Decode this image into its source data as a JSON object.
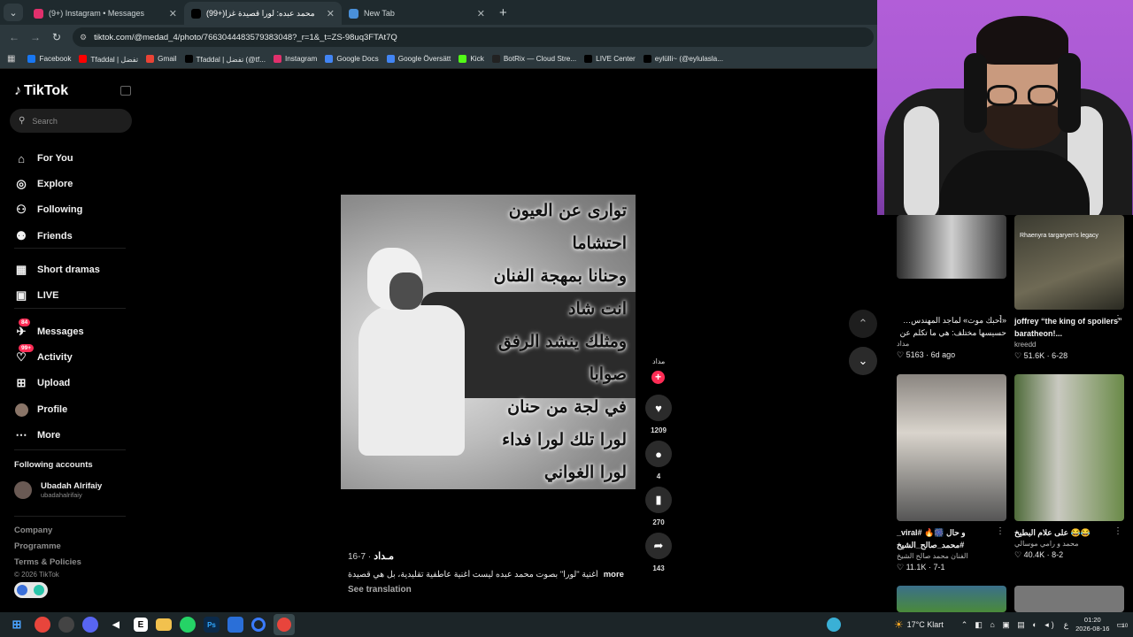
{
  "browser": {
    "tabs": [
      {
        "title": "(9+) Instagram • Messages",
        "active": false,
        "icon": "instagram-icon",
        "color": "#e1306c"
      },
      {
        "title": "(99+)محمد عبده: لورا قصيدة غزا",
        "active": true,
        "icon": "tiktok-icon",
        "color": "#000000"
      },
      {
        "title": "New Tab",
        "active": false,
        "icon": "chrome-icon",
        "color": "#4a90d9"
      }
    ],
    "url": "tiktok.com/@medad_4/photo/7663044483579383048?_r=1&_t=ZS-98uq3FTAt7Q",
    "bookmarks": [
      {
        "label": "Facebook",
        "color": "#1877f2",
        "icon": "facebook-icon"
      },
      {
        "label": "Tfaddal | تفضل",
        "color": "#ff0000",
        "icon": "youtube-icon"
      },
      {
        "label": "Gmail",
        "color": "#ea4335",
        "icon": "gmail-icon"
      },
      {
        "label": "Tfaddal | تفضل (@tf...",
        "color": "#000000",
        "icon": "tiktok-icon"
      },
      {
        "label": "Instagram",
        "color": "#e1306c",
        "icon": "instagram-icon"
      },
      {
        "label": "Google Docs",
        "color": "#4285f4",
        "icon": "docs-icon"
      },
      {
        "label": "Google Översätt",
        "color": "#4285f4",
        "icon": "translate-icon"
      },
      {
        "label": "Kick",
        "color": "#53fc18",
        "icon": "kick-icon"
      },
      {
        "label": "BotRix — Cloud Stre...",
        "color": "#222222",
        "icon": "botrix-icon"
      },
      {
        "label": "LIVE Center",
        "color": "#000000",
        "icon": "tiktok-icon"
      },
      {
        "label": "eylülli~ (@eylulasla...",
        "color": "#000000",
        "icon": "tiktok-icon"
      }
    ]
  },
  "tiktok": {
    "logo": "TikTok",
    "search_placeholder": "Search",
    "nav": [
      {
        "label": "For You",
        "icon": "home-icon"
      },
      {
        "label": "Explore",
        "icon": "compass-icon"
      },
      {
        "label": "Following",
        "icon": "following-icon"
      },
      {
        "label": "Friends",
        "icon": "friends-icon"
      },
      {
        "label": "Short dramas",
        "icon": "dramas-icon"
      },
      {
        "label": "LIVE",
        "icon": "live-icon"
      },
      {
        "label": "Messages",
        "icon": "messages-icon",
        "badge": "84"
      },
      {
        "label": "Activity",
        "icon": "activity-icon",
        "badge": "99+"
      },
      {
        "label": "Upload",
        "icon": "upload-icon"
      },
      {
        "label": "Profile",
        "icon": "avatar"
      },
      {
        "label": "More",
        "icon": "more-icon"
      }
    ],
    "following_title": "Following accounts",
    "following": {
      "name": "Ubadah Alrifaiy",
      "handle": "ubadahalrifaiy"
    },
    "footer": {
      "company": "Company",
      "programme": "Programme",
      "terms": "Terms & Policies",
      "copyright": "© 2026 TikTok"
    }
  },
  "post": {
    "poem_lines": [
      "تواری عن العیون",
      "احتشاما",
      "وحنانا بمهجة الفنان",
      "انت شاد",
      "ومثلك ينشد الرفق",
      "صوابا",
      "في لجة من حنان",
      "لورا تلك لورا فداء",
      "لورا الغواني"
    ],
    "author_short": "مداد",
    "likes": "1209",
    "comments": "4",
    "saves": "270",
    "shares": "143",
    "author": "مـداد",
    "date": "7-16",
    "caption": "أغنية \"لورا\" بصوت محمد عبده ليست أغنية عاطفية تقليدية، بل هي قصيدة",
    "more": "more",
    "see_translation": "See translation"
  },
  "recommended": [
    {
      "title": "«أحبك موت» لماجد المهندس… حسيسها مختلف: هي ما تكلم عن",
      "author": "مداد",
      "likes": "5163",
      "age": "6d ago",
      "thumb_text": ""
    },
    {
      "title": "joffrey “the king of spoilers” baratheon!...",
      "author": "kreedd",
      "likes": "51.6K",
      "age": "6-28",
      "thumb_text": "Rhaenyra targaryen's legacy"
    },
    {
      "title": "و حال 🎆🔥 #viral_ #محمد_صالح_الشيخ",
      "author": "الفنان محمد صالح الشيخ",
      "likes": "11.1K",
      "age": "7-1",
      "thumb_text": ""
    },
    {
      "title": "😂😂 على علام البطيخ",
      "author": "محمد و رامي موسالي",
      "likes": "40.4K",
      "age": "8-2",
      "thumb_text": ""
    }
  ],
  "taskbar": {
    "weather": "17°C Klart",
    "lang": "ع",
    "time": "01:20",
    "date": "2026-08-16",
    "notifications": "10"
  }
}
